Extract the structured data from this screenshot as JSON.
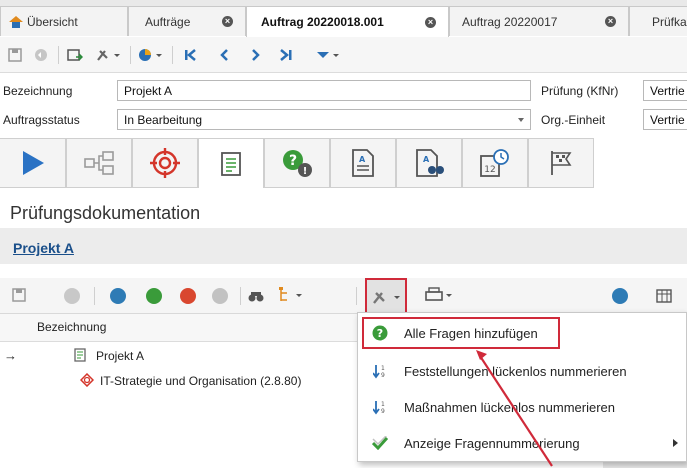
{
  "tabs": [
    {
      "label": "Übersicht"
    },
    {
      "label": "Aufträge"
    },
    {
      "label": "Auftrag 20220018.001"
    },
    {
      "label": "Auftrag 20220017"
    },
    {
      "label": "Prüfka"
    }
  ],
  "form": {
    "bezeichnung_label": "Bezeichnung",
    "bezeichnung_value": "Projekt A",
    "pruefung_label": "Prüfung (KfNr)",
    "pruefung_value": "Vertrie",
    "status_label": "Auftragsstatus",
    "status_value": "In Bearbeitung",
    "org_label": "Org.-Einheit",
    "org_value": "Vertrie"
  },
  "section": {
    "title": "Prüfungsdokumentation",
    "subtitle": "Projekt A"
  },
  "tree": {
    "column_header": "Bezeichnung",
    "rows": [
      {
        "label": "Projekt A"
      },
      {
        "label": "IT-Strategie und Organisation (2.8.80)"
      }
    ]
  },
  "menu": {
    "items": [
      {
        "label": "Alle Fragen hinzufügen"
      },
      {
        "label": "Feststellungen lückenlos nummerieren"
      },
      {
        "label": "Maßnahmen lückenlos nummerieren"
      },
      {
        "label": "Anzeige Fragennummerierung"
      }
    ]
  },
  "colors": {
    "accent_blue": "#2a6fb5",
    "highlight_red": "#d02a3a",
    "target_red": "#d4352a",
    "green": "#3a9b3a"
  },
  "icons": [
    "home-icon",
    "close-icon",
    "save-icon",
    "tools-icon",
    "chart-icon",
    "first-icon",
    "prev-icon",
    "next-icon",
    "last-icon",
    "play-icon",
    "structure-icon",
    "target-icon",
    "checklist-icon",
    "question-icon",
    "document-icon",
    "search-document-icon",
    "calendar-icon",
    "flag-icon",
    "help-icon",
    "number-sort-icon",
    "checkmark-icon",
    "printer-icon"
  ]
}
